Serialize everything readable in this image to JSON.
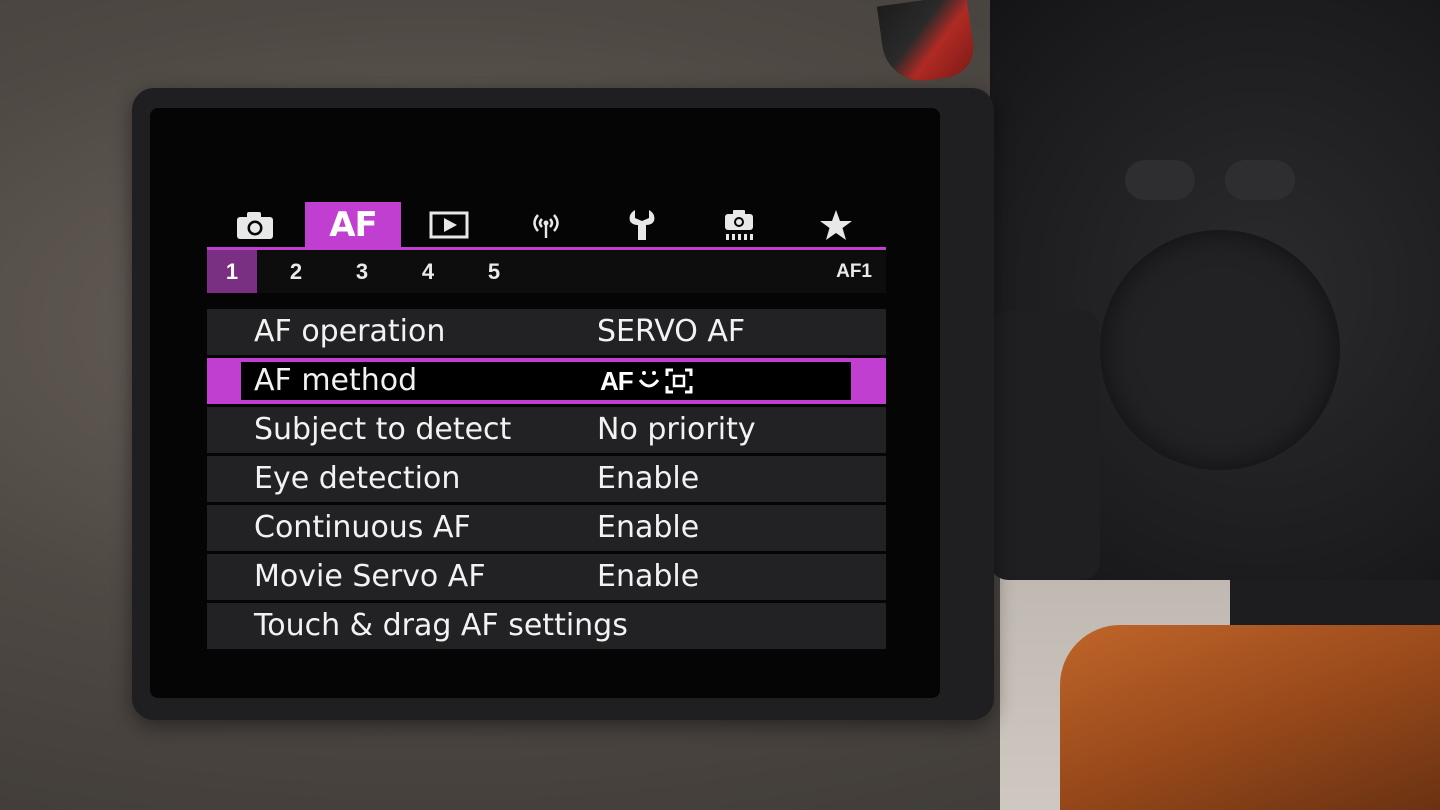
{
  "tabs": [
    {
      "icon": "camera-icon",
      "label": ""
    },
    {
      "icon": "af-tab",
      "label": "AF"
    },
    {
      "icon": "playback-icon",
      "label": ""
    },
    {
      "icon": "wireless-icon",
      "label": ""
    },
    {
      "icon": "wrench-icon",
      "label": ""
    },
    {
      "icon": "custom-functions-icon",
      "label": ""
    },
    {
      "icon": "star-icon",
      "label": ""
    }
  ],
  "active_tab": 1,
  "subtabs": [
    "1",
    "2",
    "3",
    "4",
    "5"
  ],
  "active_subtab": 0,
  "page_id": "AF1",
  "rows": [
    {
      "label": "AF operation",
      "value": "SERVO AF"
    },
    {
      "label": "AF method",
      "value": "",
      "value_icon": "af-face-tracking-icon"
    },
    {
      "label": "Subject to detect",
      "value": "No priority"
    },
    {
      "label": "Eye detection",
      "value": "Enable"
    },
    {
      "label": "Continuous AF",
      "value": "Enable"
    },
    {
      "label": "Movie Servo AF",
      "value": "Enable"
    },
    {
      "label": "Touch & drag AF settings",
      "value": ""
    }
  ],
  "selected_row": 1,
  "colors": {
    "accent": "#c13fd0",
    "subtab_active": "#7a2f83",
    "row_bg": "#222224"
  }
}
